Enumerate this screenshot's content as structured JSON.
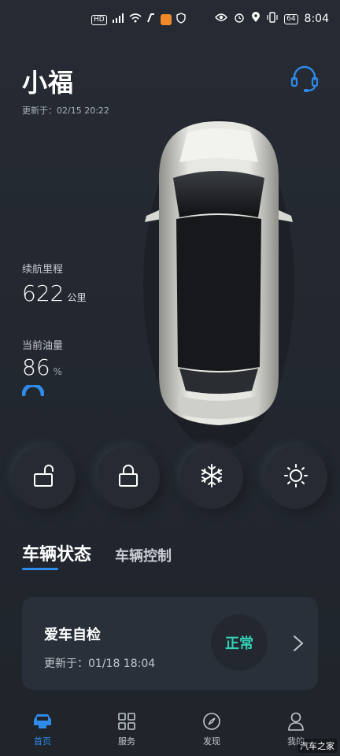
{
  "status_bar": {
    "left_icons": [
      "hd-icon",
      "5g-icon",
      "signal-icon",
      "wifi-icon",
      "app-icon",
      "orange-app-icon",
      "shield-icon"
    ],
    "right_icons": [
      "eye-icon",
      "alarm-icon",
      "location-icon",
      "vibrate-icon"
    ],
    "hd_label": "HD",
    "battery": "64",
    "time": "8:04"
  },
  "header": {
    "title": "小福",
    "updated": "更新于：02/15 20:22"
  },
  "metrics": {
    "range_label": "续航里程",
    "range_value": "622",
    "range_unit": "公里",
    "fuel_label": "当前油量",
    "fuel_value": "86",
    "fuel_unit": "%",
    "fuel_level": 0.86
  },
  "controls": [
    {
      "name": "unlock-icon"
    },
    {
      "name": "lock-icon"
    },
    {
      "name": "snowflake-icon"
    },
    {
      "name": "sun-icon"
    }
  ],
  "tabs": {
    "active": "车辆状态",
    "inactive": "车辆控制"
  },
  "check_card": {
    "title": "爱车自检",
    "updated": "更新于：01/18 18:04",
    "status": "正常"
  },
  "bottom_nav": [
    {
      "label": "首页",
      "icon": "car-icon"
    },
    {
      "label": "服务",
      "icon": "grid-icon"
    },
    {
      "label": "发现",
      "icon": "compass-icon"
    },
    {
      "label": "我的",
      "icon": "person-icon"
    }
  ],
  "watermark": "汽车之家",
  "colors": {
    "accent": "#2f8bea",
    "status_ok": "#32d1b5",
    "background": "#232831"
  }
}
